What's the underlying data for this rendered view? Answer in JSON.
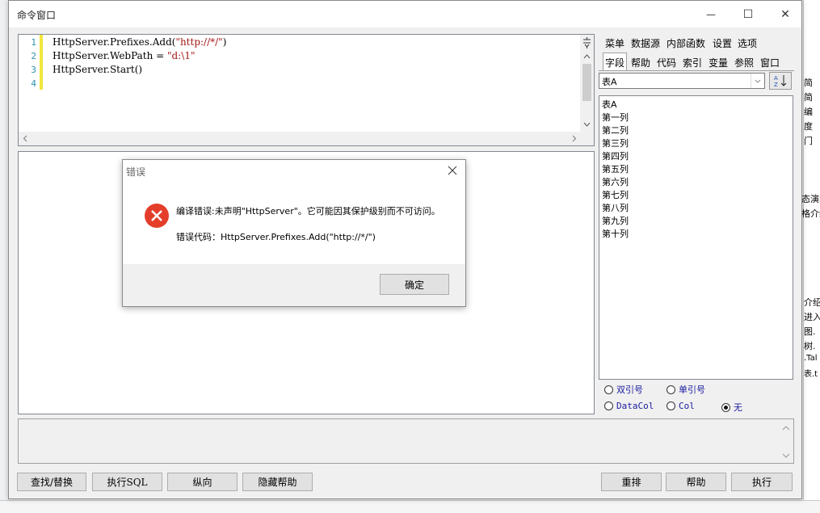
{
  "window": {
    "title": "命令窗口",
    "controls": {
      "minimize": "—",
      "maximize": "☐",
      "close": "✕"
    }
  },
  "editor": {
    "line_numbers": [
      "1",
      "2",
      "3",
      "4"
    ],
    "lines": [
      {
        "pre": "HttpServer.Prefixes.Add(",
        "str": "\"http://*/\"",
        "post": ")"
      },
      {
        "pre": "HttpServer.WebPath = ",
        "str": "\"d:\\1\"",
        "post": ""
      },
      {
        "pre": "HttpServer.Start()",
        "str": "",
        "post": ""
      }
    ]
  },
  "right_panel": {
    "menu_row1": [
      "菜单",
      "数据源",
      "内部函数",
      "设置",
      "选项"
    ],
    "menu_row2": [
      "字段",
      "帮助",
      "代码",
      "索引",
      "变量",
      "参照",
      "窗口"
    ],
    "selected_tab": "字段",
    "table_select": "表A",
    "field_list": [
      "表A",
      "第一列",
      "第二列",
      "第三列",
      "第四列",
      "第五列",
      "第六列",
      "第七列",
      "第八列",
      "第九列",
      "第十列"
    ],
    "radios": [
      {
        "label": "双引号",
        "checked": false
      },
      {
        "label": "单引号",
        "checked": false
      },
      {
        "label": "DataCol",
        "checked": false
      },
      {
        "label": "Col",
        "checked": false
      },
      {
        "label": "无",
        "checked": true
      }
    ]
  },
  "buttons": {
    "find_replace": "查找/替换",
    "exec_sql": "执行SQL",
    "vertical": "纵向",
    "hide_help": "隐藏帮助",
    "reset": "重排",
    "help": "帮助",
    "execute": "执行"
  },
  "dialog": {
    "title": "错误",
    "message": "编译错误:未声明\"HttpServer\"。它可能因其保护级别而不可访问。",
    "code_line": "错误代码：HttpServer.Prefixes.Add(\"http://*/\")",
    "ok_button": "确定"
  },
  "background": {
    "right_fragments": [
      "简",
      "简",
      "编",
      "度",
      "门",
      "态演示",
      "格介绍",
      "介绍",
      "进入界",
      "图.",
      "树.",
      ".Tal",
      "表.t"
    ]
  }
}
